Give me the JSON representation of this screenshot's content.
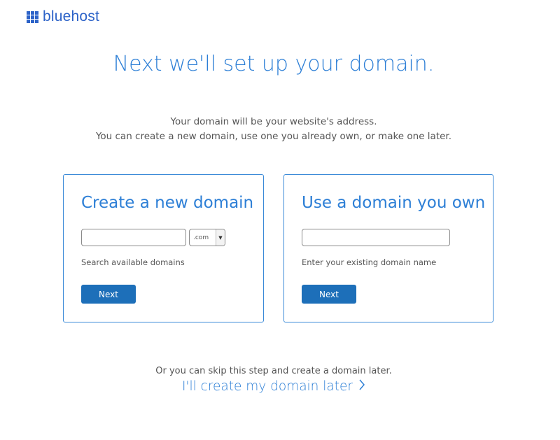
{
  "brand": {
    "name": "bluehost",
    "logo_icon": "grid-icon",
    "color": "#2d63c8"
  },
  "headline": "Next we'll set up your domain.",
  "intro": {
    "line1": "Your domain will be your website's address.",
    "line2": "You can create a new domain, use one you already own, or make one later."
  },
  "new_domain": {
    "title": "Create a new domain",
    "input_value": "",
    "tld_selected": ".com",
    "help": "Search available domains",
    "button_label": "Next"
  },
  "own_domain": {
    "title": "Use a domain you own",
    "input_value": "",
    "help": "Enter your existing domain name",
    "button_label": "Next"
  },
  "skip": {
    "text": "Or you can skip this step and create a domain later.",
    "link_label": "I'll create my domain later",
    "link_icon": "chevron-right-icon"
  },
  "colors": {
    "accent": "#2d7fd6",
    "button": "#1d6fb9",
    "card_border": "#3b8ad8"
  }
}
